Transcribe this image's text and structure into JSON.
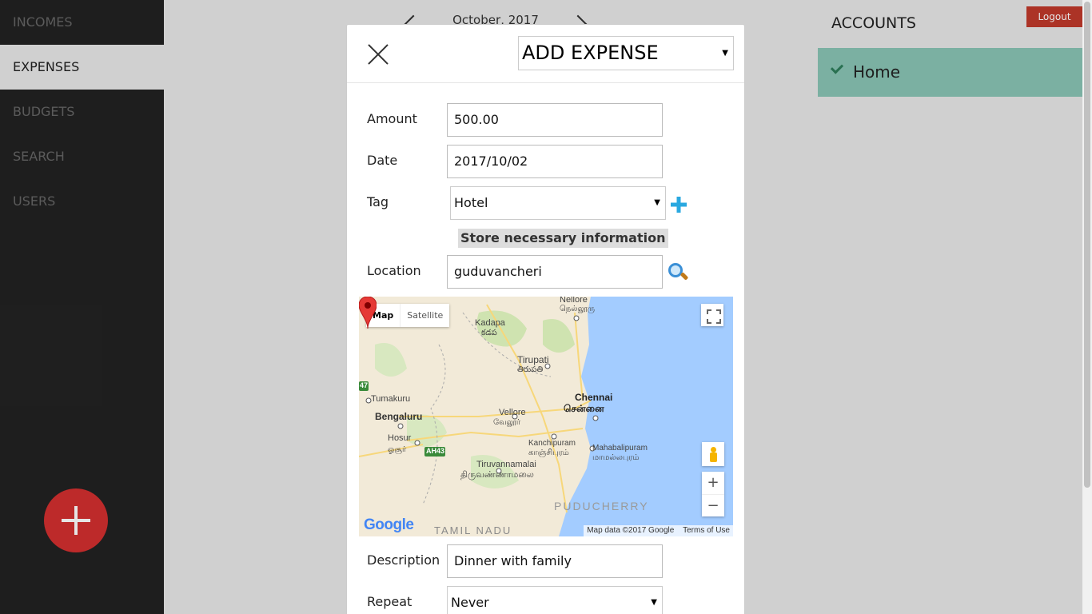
{
  "sidebar": {
    "items": [
      {
        "label": "INCOMES"
      },
      {
        "label": "EXPENSES"
      },
      {
        "label": "BUDGETS"
      },
      {
        "label": "SEARCH"
      },
      {
        "label": "USERS"
      }
    ],
    "active_index": 1
  },
  "header": {
    "month_label": "October, 2017"
  },
  "accounts": {
    "title": "ACCOUNTS",
    "logout_label": "Logout",
    "items": [
      {
        "label": "Home",
        "selected": true
      }
    ]
  },
  "modal": {
    "type_selected": "ADD EXPENSE",
    "fields": {
      "amount": {
        "label": "Amount",
        "value": "500.00"
      },
      "date": {
        "label": "Date",
        "value": "2017/10/02"
      },
      "tag": {
        "label": "Tag",
        "value": "Hotel"
      },
      "info": "Store necessary information",
      "location": {
        "label": "Location",
        "value": "guduvancheri"
      },
      "description": {
        "label": "Description",
        "value": "Dinner with family"
      },
      "repeat": {
        "label": "Repeat",
        "value": "Never"
      }
    },
    "map": {
      "type_map": "Map",
      "type_satellite": "Satellite",
      "attribution": "Map data ©2017 Google",
      "terms": "Terms of Use",
      "logo": "Google",
      "places": [
        {
          "name": "Nellore"
        },
        {
          "name": "நெல்லூரு"
        },
        {
          "name": "Kadapa"
        },
        {
          "name": "కడప"
        },
        {
          "name": "Tirupati"
        },
        {
          "name": "తిరుపతి"
        },
        {
          "name": "Tumakuru"
        },
        {
          "name": "Chennai"
        },
        {
          "name": "சென்னை"
        },
        {
          "name": "Bengaluru"
        },
        {
          "name": "Vellore"
        },
        {
          "name": "வேலூர்"
        },
        {
          "name": "Hosur"
        },
        {
          "name": "ஓசூர்"
        },
        {
          "name": "Kanchipuram"
        },
        {
          "name": "காஞ்சிபுரம்"
        },
        {
          "name": "Mahabalipuram"
        },
        {
          "name": "மாமல்லபுரம்"
        },
        {
          "name": "Tiruvannamalai"
        },
        {
          "name": "திருவண்ணாமலை"
        },
        {
          "name": "PUDUCHERRY"
        },
        {
          "name": "TAMIL NADU"
        },
        {
          "name": "AH43"
        },
        {
          "name": "47"
        }
      ]
    }
  },
  "colors": {
    "sidebar_bg": "#222222",
    "fab": "#d32f2f",
    "logout": "#c0392b",
    "account_selected": "#8ac5b5",
    "tag_add": "#29a8e0",
    "map_water": "#a3ccff"
  },
  "icons": {
    "close": "close-icon",
    "add_tag": "plus-icon",
    "search": "search-icon",
    "fab": "plus-icon",
    "account_check": "check-icon",
    "fullscreen": "fullscreen-icon",
    "pegman": "pegman-icon",
    "marker": "map-marker-icon"
  }
}
